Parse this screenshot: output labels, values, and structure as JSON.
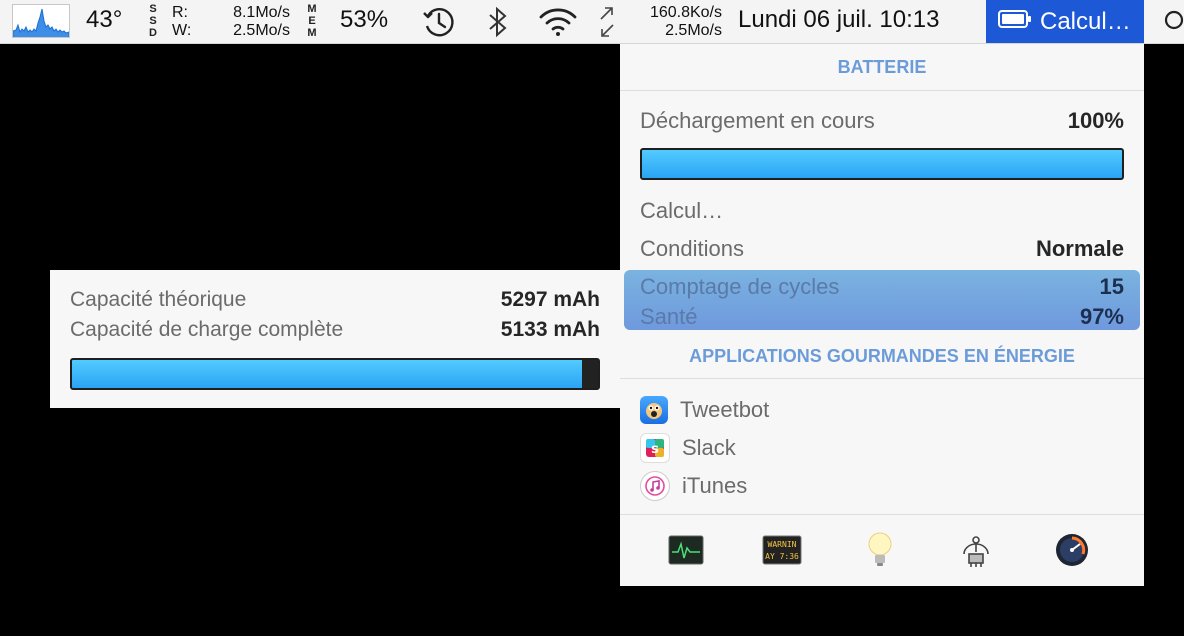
{
  "menubar": {
    "temperature": "43°",
    "ssd_label": "SSD",
    "ssd_read_label": "R:",
    "ssd_write_label": "W:",
    "ssd_read": "8.1Mo/s",
    "ssd_write": "2.5Mo/s",
    "mem_label": "MEM",
    "mem_value": "53%",
    "net_up": "160.8Ko/s",
    "net_down": "2.5Mo/s",
    "clock": "Lundi 06 juil. 10:13",
    "battery_label": "Calcul…",
    "icons": [
      "cpu-graph-icon",
      "time-machine-icon",
      "bluetooth-icon",
      "wifi-icon",
      "network-arrows-icon",
      "battery-icon",
      "search-icon"
    ]
  },
  "battery_menu": {
    "title": "BATTERIE",
    "status": {
      "label": "Déchargement en cours",
      "value": "100%"
    },
    "charge_fraction": 1.0,
    "calculating": "Calcul…",
    "conditions": {
      "label": "Conditions",
      "value": "Normale"
    },
    "cycles": {
      "label": "Comptage de cycles",
      "value": "15"
    },
    "health": {
      "label": "Santé",
      "value": "97%"
    },
    "apps_title": "APPLICATIONS GOURMANDES EN ÉNERGIE",
    "apps": [
      {
        "name": "Tweetbot",
        "icon": "tweetbot-icon"
      },
      {
        "name": "Slack",
        "icon": "slack-icon"
      },
      {
        "name": "iTunes",
        "icon": "itunes-icon"
      }
    ],
    "toolbar": [
      "activity-monitor-icon",
      "console-icon",
      "energy-saver-icon",
      "system-information-icon",
      "istat-icon"
    ],
    "console_icon_text": [
      "WARNIN",
      "AY 7:36"
    ]
  },
  "tooltip": {
    "design_capacity": {
      "label": "Capacité théorique",
      "value": "5297 mAh"
    },
    "full_charge_capacity": {
      "label": "Capacité de charge complète",
      "value": "5133 mAh"
    },
    "capacity_fraction": 0.969
  },
  "colors": {
    "accent": "#1d59d6",
    "section_title": "#6c9bd9",
    "bar_fill": "#2aa4f4",
    "highlight": "#7aa6df"
  }
}
